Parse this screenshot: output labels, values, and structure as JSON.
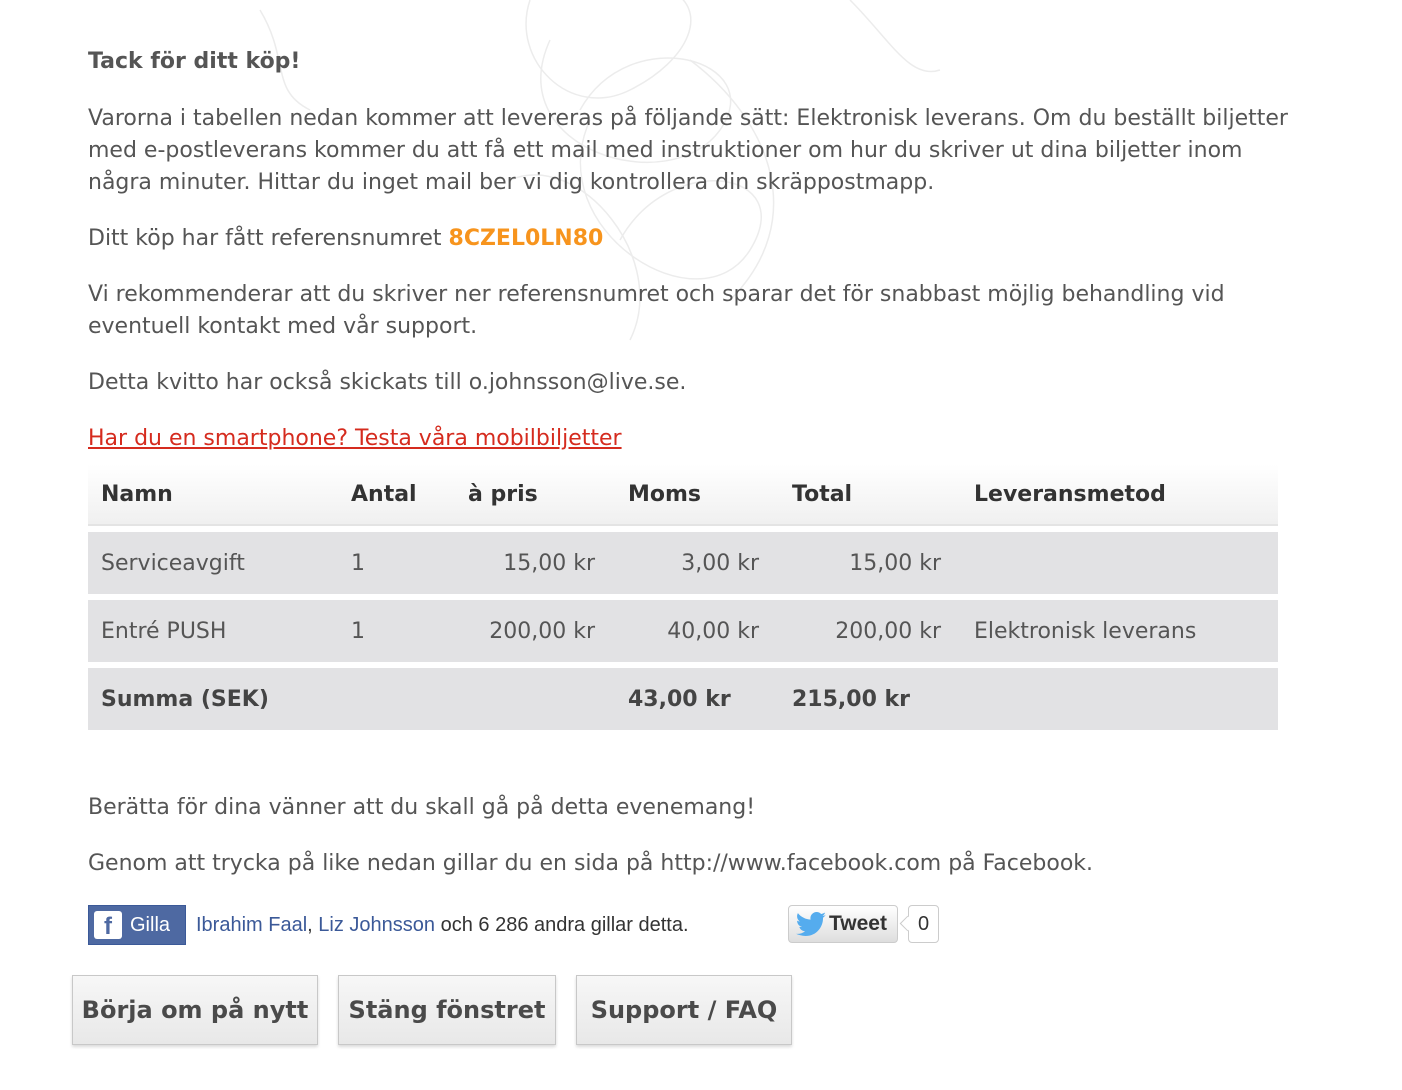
{
  "heading": "Tack för ditt köp!",
  "delivery_text": "Varorna i tabellen nedan kommer att levereras på följande sätt: Elektronisk leverans. Om du beställt biljetter med e-postleverans kommer du att få ett mail med instruktioner om hur du skriver ut dina biljetter inom några minuter. Hittar du inget mail ber vi dig kontrollera din skräppostmapp.",
  "reference": {
    "prefix": "Ditt köp har fått referensnumret ",
    "number": "8CZEL0LN80"
  },
  "recommend_text": "Vi rekommenderar att du skriver ner referensnumret och sparar det för snabbast möjlig behandling vid eventuell kontakt med vår support.",
  "receipt_text": "Detta kvitto har också skickats till o.johnsson@live.se.",
  "mobile_link": "Har du en smartphone? Testa våra mobilbiljetter",
  "table": {
    "headers": [
      "Namn",
      "Antal",
      "à pris",
      "Moms",
      "Total",
      "Leveransmetod"
    ],
    "rows": [
      {
        "name": "Serviceavgift",
        "qty": "1",
        "price": "15,00 kr",
        "vat": "3,00 kr",
        "total": "15,00 kr",
        "method": ""
      },
      {
        "name": "Entré PUSH",
        "qty": "1",
        "price": "200,00 kr",
        "vat": "40,00 kr",
        "total": "200,00 kr",
        "method": "Elektronisk leverans"
      }
    ],
    "sum": {
      "label": "Summa (SEK)",
      "vat": "43,00 kr",
      "total": "215,00 kr"
    }
  },
  "share_text": "Berätta för dina vänner att du skall gå på detta evenemang!",
  "facebook_text": "Genom att trycka på like nedan gillar du en sida på http://www.facebook.com på Facebook.",
  "social": {
    "like_label": "Gilla",
    "like_logo": "f",
    "friend1": "Ibrahim Faal",
    "separator": ", ",
    "friend2": "Liz Johnsson",
    "like_suffix": " och 6 286 andra gillar detta.",
    "tweet_label": "Tweet",
    "tweet_count": "0"
  },
  "buttons": {
    "restart": "Börja om på nytt",
    "close": "Stäng fönstret",
    "support": "Support / FAQ"
  },
  "colors": {
    "reference": "#f7941d",
    "link": "#d52b1e",
    "facebook": "#4e69a2",
    "twitter": "#55acee"
  }
}
